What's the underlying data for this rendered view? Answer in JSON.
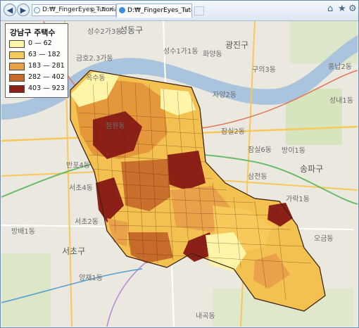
{
  "browser": {
    "address_text": "D:₩_FingerEyes_Tutorials",
    "address_tools": "ρ - ↻ ×",
    "tab_title": "D:₩_FingerEyes_Tutorials_...",
    "tab_close": "×",
    "back_icon": "◀",
    "forward_icon": "▶",
    "home_icon": "⌂",
    "star_icon": "★",
    "gear_icon": "⚙"
  },
  "legend": {
    "title": "강남구 주택수",
    "items": [
      {
        "label": "0 — 62",
        "color": "#fff5a8"
      },
      {
        "label": "63 — 182",
        "color": "#f7c95a"
      },
      {
        "label": "183 — 281",
        "color": "#e9a24a"
      },
      {
        "label": "282 — 402",
        "color": "#c66b2a"
      },
      {
        "label": "403 — 923",
        "color": "#8c1f16"
      }
    ]
  },
  "districts": {
    "seongdong": "성동구",
    "gwangjin": "광진구",
    "seocho": "서초구",
    "songpa": "송파구",
    "guui3": "구의3동",
    "jayang2": "자양2동",
    "jamsil2": "잠실2동",
    "jamsil6": "잠실6동",
    "samseong": "삼전동",
    "bangi1": "방이1동",
    "garak": "가락1동",
    "yangjae1": "양재1동",
    "naegok": "내곡동",
    "banpo4": "반포4동",
    "seocho4": "서초4동",
    "seocho2": "서초2동",
    "bangbae": "방배1동",
    "sungsu2": "성수2가3동",
    "sungsu1": "성수1가1동",
    "geumho": "금호2.3가동",
    "oksu": "옥수동",
    "jamwon": "잠원동",
    "hwayang": "화양동",
    "ogeum": "오금동",
    "seongnae": "성내1동",
    "pungnap": "풍납2동"
  }
}
